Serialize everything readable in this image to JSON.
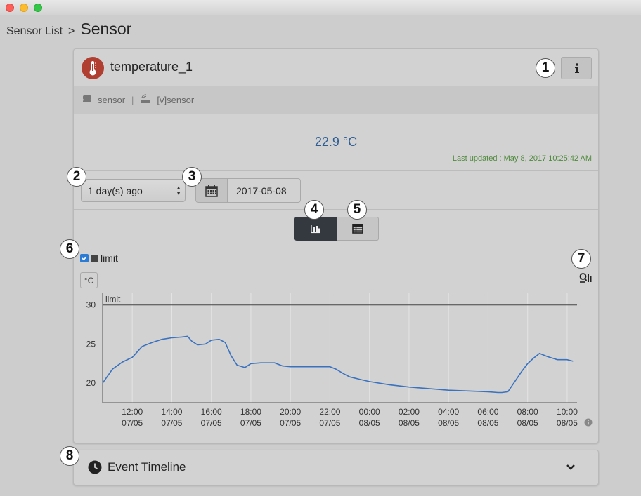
{
  "breadcrumb": {
    "parent": "Sensor List",
    "separator": ">",
    "current": "Sensor"
  },
  "sensor": {
    "name": "temperature_1",
    "type": "sensor",
    "gateway": "[v]sensor",
    "current_value": "22.9 °C",
    "last_updated": "Last updated : May 8, 2017 10:25:42 AM"
  },
  "controls": {
    "period": "1 day(s) ago",
    "date": "2017-05-08"
  },
  "legend": {
    "label": "limit",
    "checked": true
  },
  "unit_button": "°C",
  "chart_data": {
    "type": "line",
    "ylim": [
      17.5,
      31.5
    ],
    "yticks": [
      20,
      25,
      30
    ],
    "x_ticks": [
      {
        "time": "12:00",
        "date": "07/05"
      },
      {
        "time": "14:00",
        "date": "07/05"
      },
      {
        "time": "16:00",
        "date": "07/05"
      },
      {
        "time": "18:00",
        "date": "07/05"
      },
      {
        "time": "20:00",
        "date": "07/05"
      },
      {
        "time": "22:00",
        "date": "07/05"
      },
      {
        "time": "00:00",
        "date": "08/05"
      },
      {
        "time": "02:00",
        "date": "08/05"
      },
      {
        "time": "04:00",
        "date": "08/05"
      },
      {
        "time": "06:00",
        "date": "08/05"
      },
      {
        "time": "08:00",
        "date": "08/05"
      },
      {
        "time": "10:00",
        "date": "08/05"
      }
    ],
    "limit": {
      "label": "limit",
      "value": 30
    },
    "series": [
      {
        "color": "#3a72bf",
        "hours": [
          10.5,
          11.0,
          11.5,
          12.0,
          12.5,
          13.0,
          13.5,
          14.0,
          14.5,
          14.8,
          15.0,
          15.3,
          15.7,
          16.0,
          16.4,
          16.7,
          17.0,
          17.3,
          17.7,
          18.0,
          18.5,
          19.0,
          19.2,
          19.6,
          20.0,
          20.5,
          21.0,
          22.0,
          22.3,
          22.7,
          23.0,
          23.5,
          24.0,
          25.0,
          26.0,
          27.0,
          28.0,
          29.0,
          30.0,
          30.5,
          30.7,
          31.0,
          31.3,
          31.7,
          32.0,
          32.3,
          32.6,
          33.0,
          33.5,
          34.0,
          34.3
        ],
        "values": [
          20.0,
          21.8,
          22.7,
          23.3,
          24.7,
          25.2,
          25.6,
          25.8,
          25.9,
          26.0,
          25.4,
          24.9,
          25.0,
          25.5,
          25.6,
          25.2,
          23.5,
          22.3,
          22.0,
          22.5,
          22.6,
          22.6,
          22.6,
          22.2,
          22.1,
          22.1,
          22.1,
          22.1,
          21.8,
          21.2,
          20.8,
          20.5,
          20.2,
          19.8,
          19.5,
          19.3,
          19.1,
          19.0,
          18.9,
          18.8,
          18.8,
          18.9,
          20.0,
          21.5,
          22.5,
          23.2,
          23.8,
          23.4,
          23.0,
          23.0,
          22.8
        ]
      }
    ]
  },
  "event_timeline": {
    "title": "Event Timeline"
  },
  "callouts": [
    "1",
    "2",
    "3",
    "4",
    "5",
    "6",
    "7",
    "8"
  ]
}
